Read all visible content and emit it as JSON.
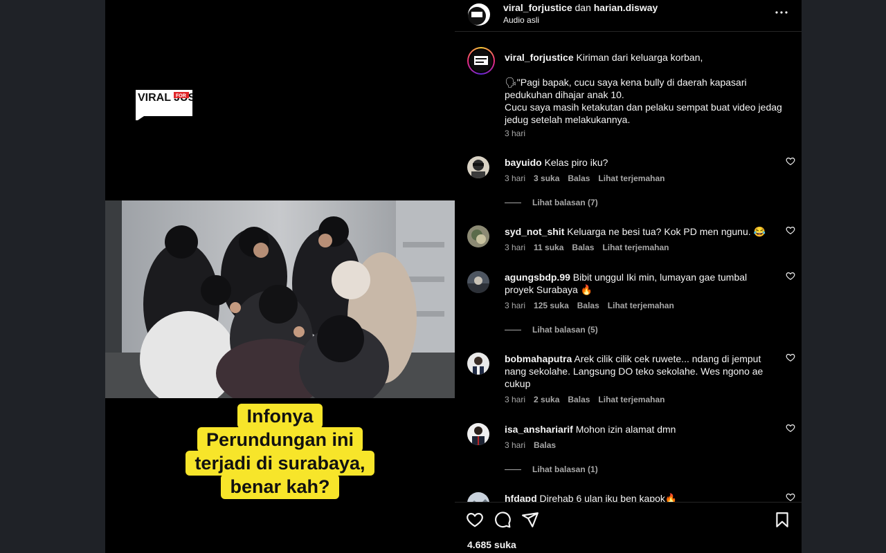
{
  "media": {
    "logo_text": "VIRAL JUSTICE",
    "logo_small": "FOR",
    "caption_lines": [
      "Infonya",
      "Perundungan ini",
      "terjadi di surabaya,",
      "benar kah?"
    ]
  },
  "header": {
    "user1": "viral_forjustice",
    "joiner": "dan",
    "user2": "harian.disway",
    "audio": "Audio asli",
    "more_icon": "more-horizontal-icon"
  },
  "caption": {
    "username": "viral_forjustice",
    "first_line": "Kiriman dari keluarga korban,",
    "second_line": "🗣\"Pagi bapak, cucu saya kena bully di daerah kapasari pedukuhan dihajar anak 10.",
    "third_line": "Cucu saya masih ketakutan dan pelaku sempat buat video jedag jedug setelah melakukannya.",
    "time": "3 hari"
  },
  "comments": [
    {
      "username": "bayuido",
      "text": "Kelas piro iku?",
      "time": "3 hari",
      "likes": "3 suka",
      "reply": "Balas",
      "translate": "Lihat terjemahan",
      "replies": "Lihat balasan (7)"
    },
    {
      "username": "syd_not_shit",
      "text": "Keluarga ne besi tua? Kok PD men ngunu. 😂",
      "time": "3 hari",
      "likes": "11 suka",
      "reply": "Balas",
      "translate": "Lihat terjemahan"
    },
    {
      "username": "agungsbdp.99",
      "text": "Bibit unggul Iki min, lumayan gae tumbal proyek Surabaya 🔥",
      "time": "3 hari",
      "likes": "125 suka",
      "reply": "Balas",
      "translate": "Lihat terjemahan",
      "replies": "Lihat balasan (5)"
    },
    {
      "username": "bobmahaputra",
      "text": "Arek cilik cilik cek ruwete... ndang di jemput nang sekolahe. Langsung DO teko sekolahe. Wes ngono ae cukup",
      "time": "3 hari",
      "likes": "2 suka",
      "reply": "Balas",
      "translate": "Lihat terjemahan"
    },
    {
      "username": "isa_anshariarif",
      "text": "Mohon izin alamat dmn",
      "time": "3 hari",
      "reply": "Balas",
      "replies": "Lihat balasan (1)"
    },
    {
      "username": "hfdapd",
      "text": "Direhab 6 ulan iku ben kapok🔥"
    }
  ],
  "actions": {
    "like_icon": "heart-icon",
    "comment_icon": "comment-icon",
    "share_icon": "paper-plane-icon",
    "save_icon": "bookmark-icon",
    "likes": "4.685 suka"
  },
  "colors": {
    "background": "#222529",
    "panel": "#000000",
    "caption_highlight": "#f7e52a",
    "muted_text": "#a8a8a8"
  }
}
